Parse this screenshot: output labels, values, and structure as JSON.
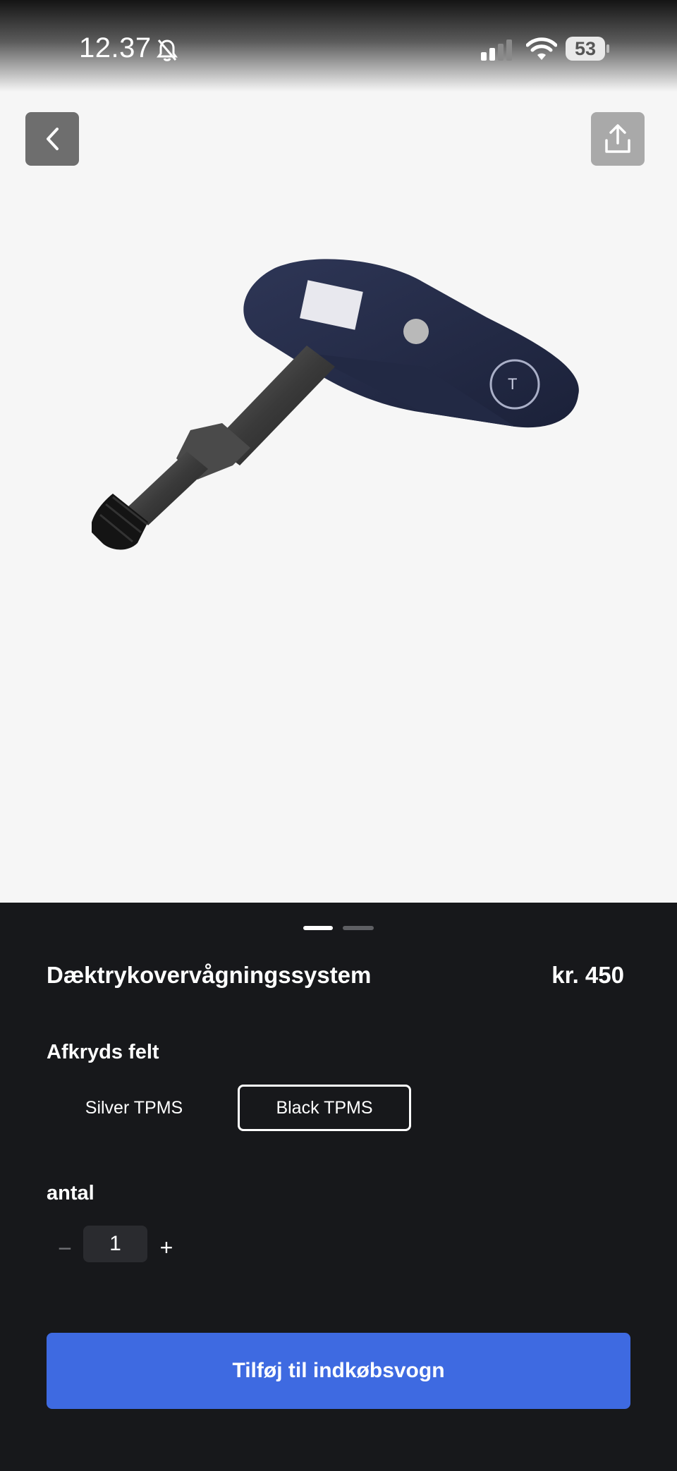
{
  "status_bar": {
    "time": "12.37",
    "battery": "53",
    "icons": [
      "bell-muted-icon",
      "signal-icon",
      "wifi-icon",
      "battery-icon"
    ]
  },
  "header": {
    "back_icon": "chevron-left-icon",
    "share_icon": "share-upload-icon"
  },
  "gallery": {
    "image": "tpms-sensor-image",
    "pages": 2,
    "active_page": 1
  },
  "product": {
    "title": "Dæktrykovervågningssystem",
    "price": "kr. 450"
  },
  "options": {
    "label": "Afkryds felt",
    "items": [
      {
        "label": "Silver TPMS",
        "selected": false
      },
      {
        "label": "Black TPMS",
        "selected": true
      }
    ]
  },
  "quantity": {
    "label": "antal",
    "value": "1",
    "minus": "−",
    "plus": "+"
  },
  "cart": {
    "button_label": "Tilføj til indkøbsvogn"
  },
  "colors": {
    "sheet_background": "#17181b",
    "hero_background": "#f6f6f6",
    "primary_button": "#3e6ae1"
  }
}
